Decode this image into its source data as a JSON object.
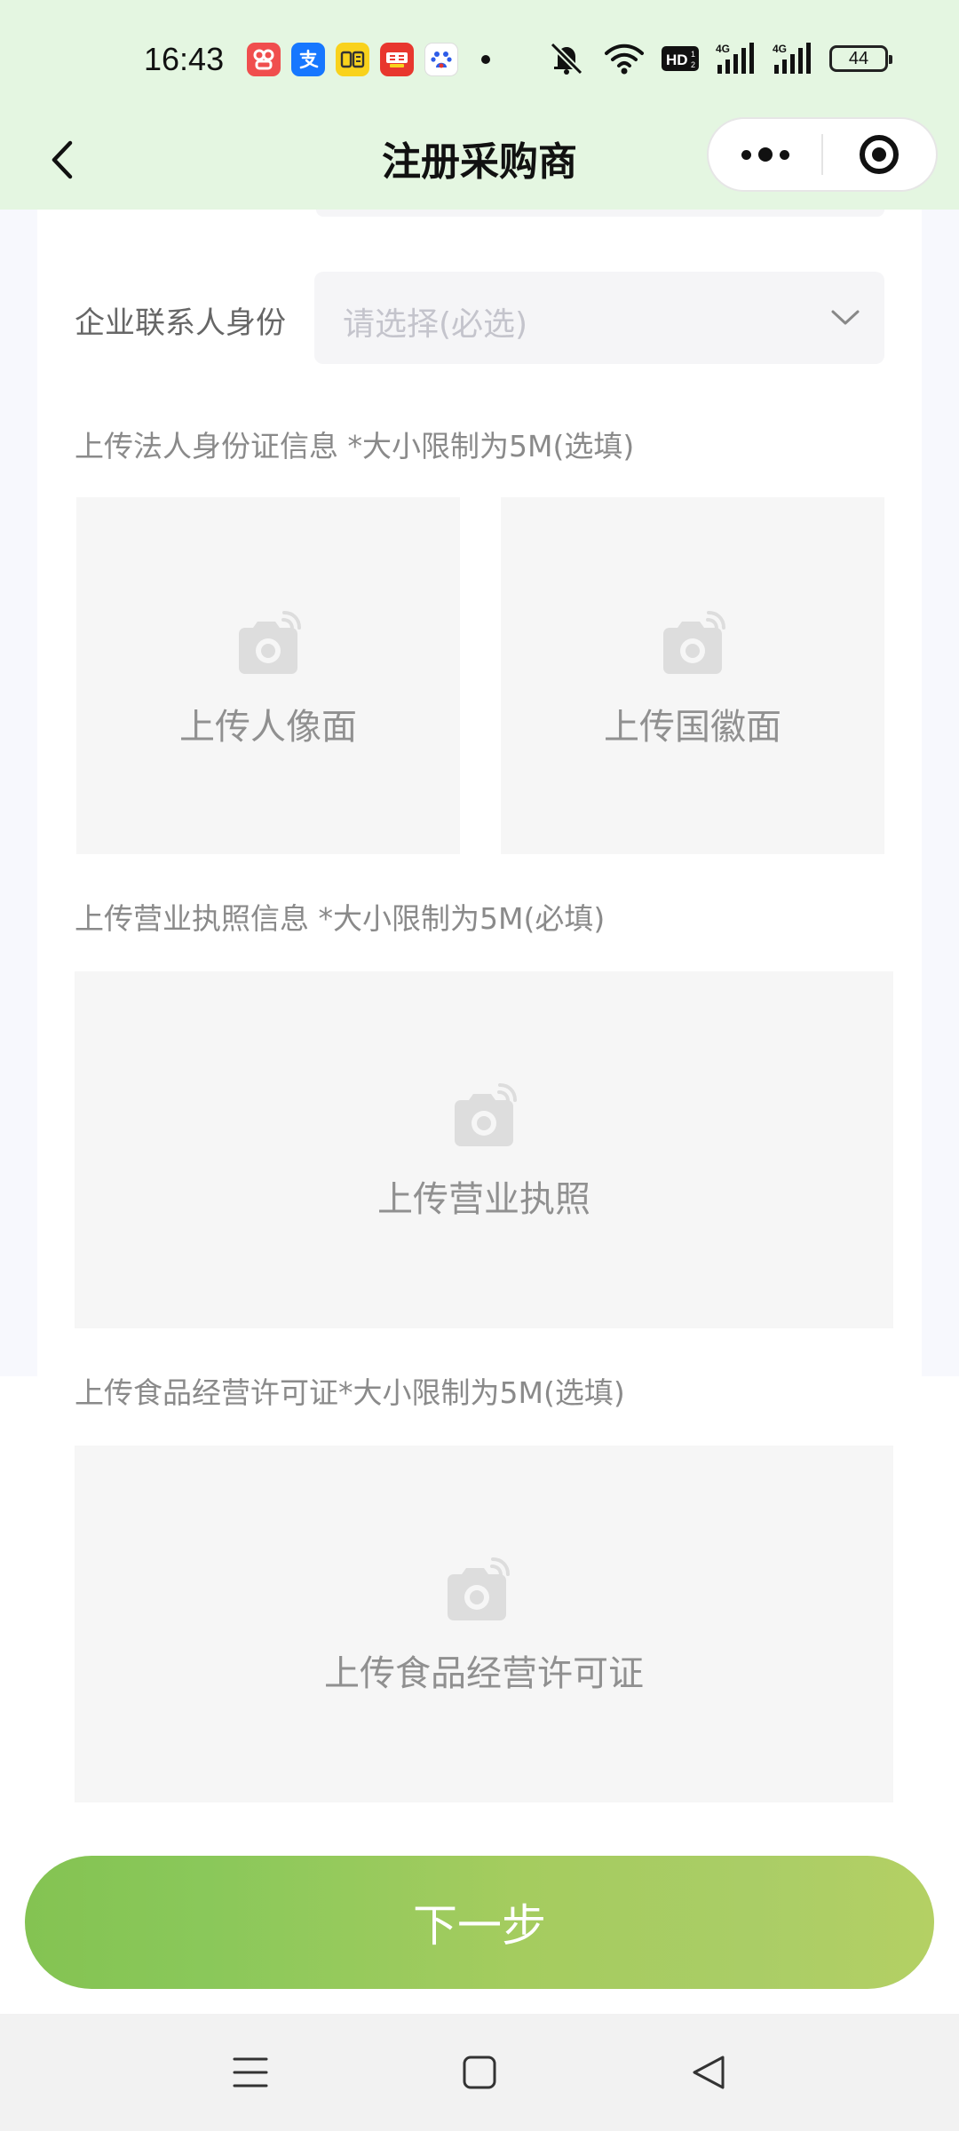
{
  "status_bar": {
    "time": "16:43",
    "app_icons": [
      {
        "name": "app-icon-1",
        "color": "#f04e4e",
        "glyph": "品"
      },
      {
        "name": "alipay-icon",
        "color": "#1677ff",
        "glyph": "支"
      },
      {
        "name": "app-icon-3",
        "color": "#f9d21c",
        "glyph": "闲"
      },
      {
        "name": "app-icon-4",
        "color": "#e8372e",
        "glyph": "搜"
      },
      {
        "name": "baidu-icon",
        "color": "#ffffff",
        "glyph": "🐾"
      }
    ],
    "battery_level": "44"
  },
  "nav": {
    "title": "注册采购商"
  },
  "form": {
    "contact_identity_label": "企业联系人身份",
    "contact_identity_placeholder": "请选择(必选)",
    "legal_id_section": "上传法人身份证信息 *大小限制为5M(选填)",
    "upload_portrait": "上传人像面",
    "upload_emblem": "上传国徽面",
    "business_license_section": "上传营业执照信息 *大小限制为5M(必填)",
    "upload_business_license": "上传营业执照",
    "food_license_section": "上传食品经营许可证*大小限制为5M(选填)",
    "upload_food_license": "上传食品经营许可证"
  },
  "actions": {
    "next": "下一步"
  },
  "colors": {
    "header_bg": "#e4f6e1",
    "button_gradient_start": "#84c352",
    "button_gradient_end": "#b4d064"
  }
}
